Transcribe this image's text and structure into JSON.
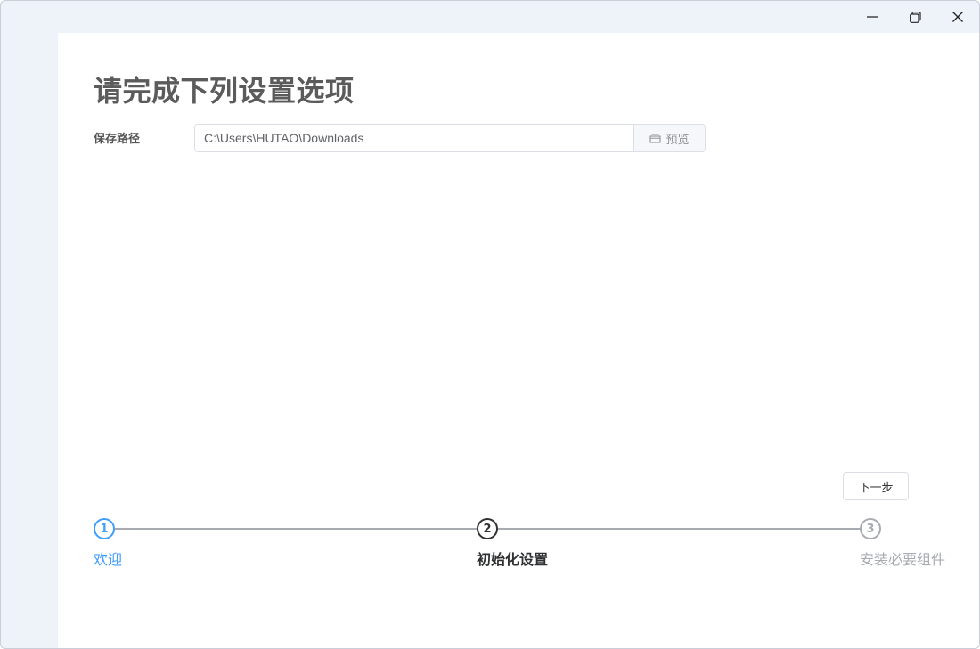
{
  "window": {
    "controls": {
      "minimize_icon": "minimize-icon",
      "restore_icon": "restore-icon",
      "close_icon": "close-icon"
    }
  },
  "page": {
    "title": "请完成下列设置选项"
  },
  "save_path": {
    "label": "保存路径",
    "value": "C:\\Users\\HUTAO\\Downloads",
    "browse_label": "预览",
    "browse_icon": "folder-icon"
  },
  "next_button": {
    "label": "下一步"
  },
  "steps": [
    {
      "number": "1",
      "label": "欢迎",
      "status": "done"
    },
    {
      "number": "2",
      "label": "初始化设置",
      "status": "active"
    },
    {
      "number": "3",
      "label": "安装必要组件",
      "status": "pending"
    }
  ],
  "colors": {
    "accent": "#409eff",
    "active": "#303133",
    "pending": "#a8abb2",
    "window_bg": "#eef2f9",
    "title_text": "#5b5b5b"
  }
}
